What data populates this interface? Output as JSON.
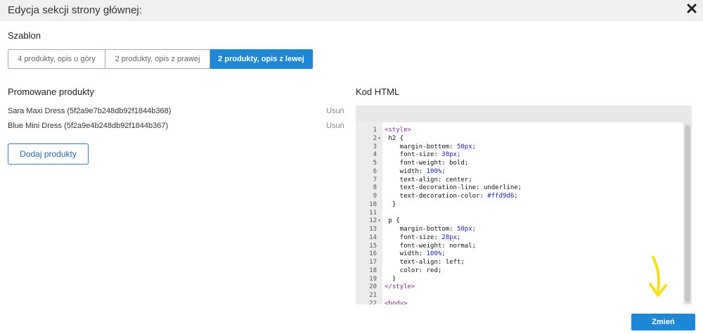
{
  "dialog": {
    "title": "Edycja sekcji strony głównej:"
  },
  "template": {
    "label": "Szablon",
    "tabs": [
      {
        "label": "4 produkty, opis u góry",
        "active": false
      },
      {
        "label": "2 produkty, opis z prawej",
        "active": false
      },
      {
        "label": "2 produkty, opis z lewej",
        "active": true
      }
    ]
  },
  "promoted": {
    "label": "Promowane produkty",
    "items": [
      {
        "name": "Sara Maxi Dress (5f2a9e7b248db92f1844b368)",
        "remove": "Usuń"
      },
      {
        "name": "Blue Mini Dress (5f2a9e4b248db92f1844b367)",
        "remove": "Usuń"
      }
    ],
    "add_label": "Dodaj produkty"
  },
  "html_code": {
    "label": "Kod HTML",
    "lines": [
      {
        "n": "1",
        "t": "<style>"
      },
      {
        "n": "2",
        "t": " h2 {",
        "fold": true
      },
      {
        "n": "3",
        "t": "    margin-bottom: 50px;"
      },
      {
        "n": "4",
        "t": "    font-size: 38px;"
      },
      {
        "n": "5",
        "t": "    font-weight: bold;"
      },
      {
        "n": "6",
        "t": "    width: 100%;"
      },
      {
        "n": "7",
        "t": "    text-align: center;"
      },
      {
        "n": "8",
        "t": "    text-decoration-line: underline;"
      },
      {
        "n": "9",
        "t": "    text-decoration-color: #ffd9d6;"
      },
      {
        "n": "10",
        "t": "  }"
      },
      {
        "n": "11",
        "t": ""
      },
      {
        "n": "12",
        "t": " p {",
        "fold": true
      },
      {
        "n": "13",
        "t": "    margin-bottom: 50px;"
      },
      {
        "n": "14",
        "t": "    font-size: 28px;"
      },
      {
        "n": "15",
        "t": "    font-weight: normal;"
      },
      {
        "n": "16",
        "t": "    width: 100%;"
      },
      {
        "n": "17",
        "t": "    text-align: left;"
      },
      {
        "n": "18",
        "t": "    color: red;"
      },
      {
        "n": "19",
        "t": "  }"
      },
      {
        "n": "20",
        "t": "</style>"
      },
      {
        "n": "21",
        "t": ""
      },
      {
        "n": "22",
        "t": "<body>"
      }
    ]
  },
  "actions": {
    "apply_label": "Zmień"
  },
  "colors": {
    "accent": "#1e88d6",
    "annotation_arrow": "#f5e01a"
  }
}
